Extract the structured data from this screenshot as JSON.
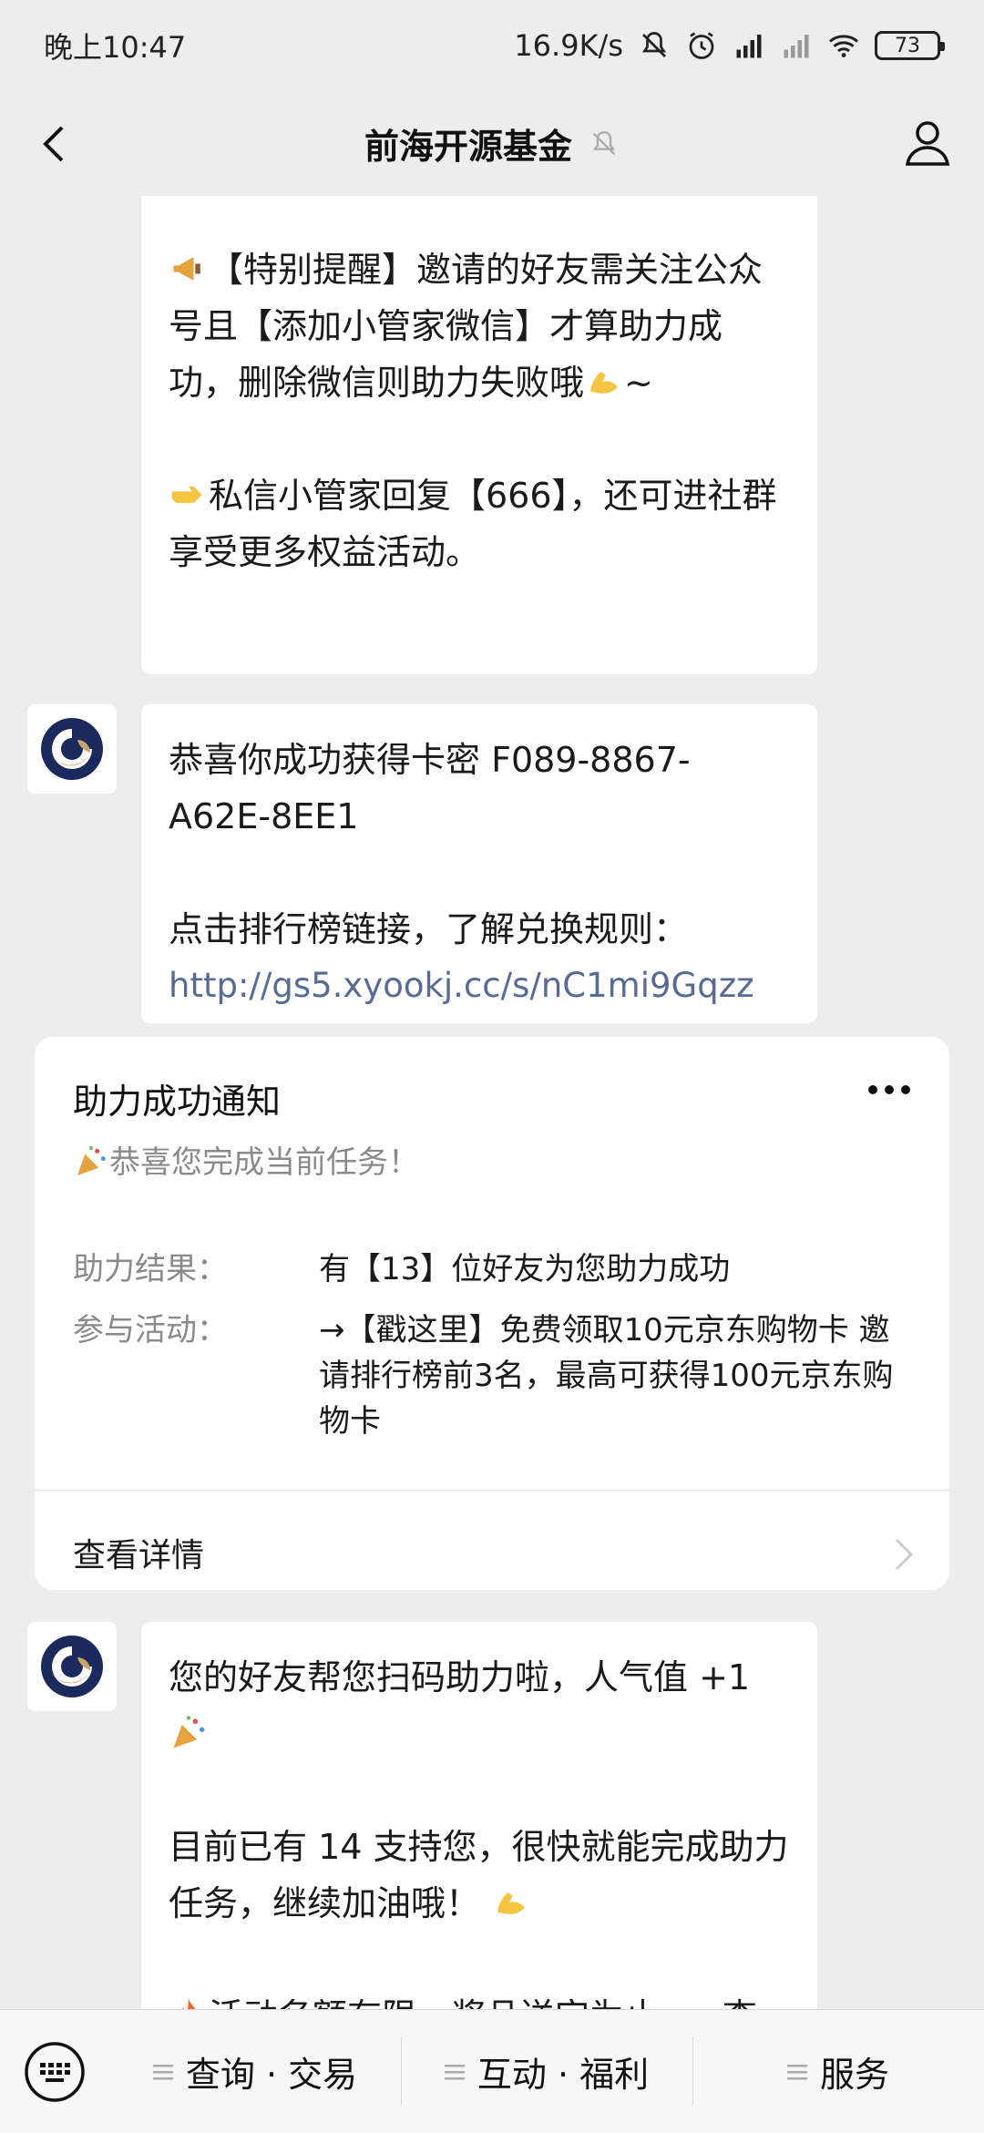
{
  "status_bar": {
    "time": "晚上10:47",
    "net_speed": "16.9K/s",
    "battery": "73"
  },
  "nav": {
    "title": "前海开源基金"
  },
  "messages": {
    "m1": {
      "p1": "【特别提醒】邀请的好友需关注公众号且【添加小管家微信】才算助力成功，删除微信则助力失败哦",
      "p1_tail": "~",
      "p2": "私信小管家回复【666】，还可进社群享受更多权益活动。"
    },
    "m2": {
      "p1": "恭喜你成功获得卡密 F089-8867-A62E-8EE1",
      "p2": "点击排行榜链接，了解兑换规则：",
      "link": "http://gs5.xyookj.cc/s/nC1mi9Gqzz"
    },
    "card": {
      "title": "助力成功通知",
      "subtitle": "恭喜您完成当前任务！",
      "rows": [
        {
          "label": "助力结果：",
          "value": "有【13】位好友为您助力成功"
        },
        {
          "label": "参与活动：",
          "value": "→【戳这里】免费领取10元京东购物卡 邀请排行榜前3名，最高可获得100元京东购物卡"
        }
      ],
      "footer": "查看详情"
    },
    "m3": {
      "p1": "您的好友帮您扫码助力啦，人气值 +1",
      "p2": "目前已有 14 支持您，很快就能完成助力任务，继续加油哦！",
      "p3": "活动名额有限，奖品送完为止，→查"
    }
  },
  "bottom_menu": {
    "items": [
      "查询 · 交易",
      "互动 · 福利",
      "服务"
    ]
  },
  "colors": {
    "background": "#EDEDED",
    "link": "#576B95",
    "avatar_navy": "#1B2A5C",
    "avatar_gold": "#C9A46A"
  }
}
